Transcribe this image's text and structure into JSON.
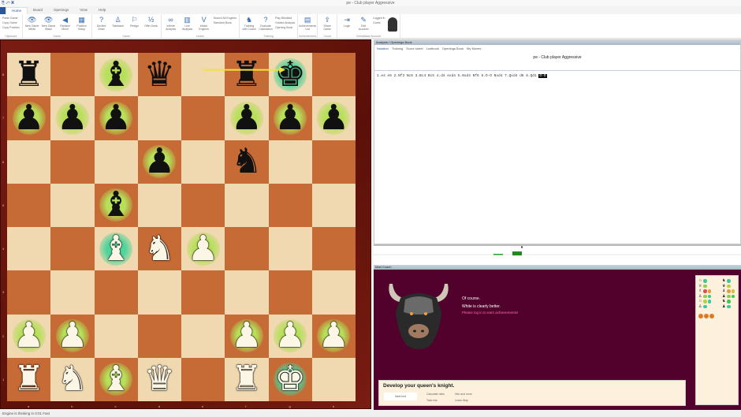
{
  "window": {
    "title": "pe - Club player Aggressive",
    "quick_access": "⎘ ↶ ▣"
  },
  "ribbon": {
    "tabs": [
      "Home",
      "Board",
      "Openings",
      "View",
      "Help"
    ],
    "groups": [
      {
        "label": "Clipboard",
        "small": [
          "Paste Game",
          "Copy Game",
          "Copy Position"
        ],
        "buttons": []
      },
      {
        "label": "Game",
        "buttons": [
          {
            "label": "New Game White",
            "icon": "👁"
          },
          {
            "label": "New Game Black",
            "icon": "👁"
          },
          {
            "label": "Replace Move",
            "icon": "◀"
          },
          {
            "label": "Position Setup",
            "icon": "▦"
          }
        ]
      },
      {
        "label": "Game",
        "buttons": [
          {
            "label": "Decline Draw",
            "icon": "?"
          },
          {
            "label": "Takeback",
            "icon": "♙"
          },
          {
            "label": "Resign",
            "icon": "⚐"
          },
          {
            "label": "Offer Draw",
            "icon": "½"
          }
        ]
      },
      {
        "label": "Levels",
        "buttons": [
          {
            "label": "Infinite Analysis",
            "icon": "∞"
          },
          {
            "label": "Live Analysis",
            "icon": "▥"
          },
          {
            "label": "Match Engines",
            "icon": "V"
          }
        ],
        "small": [
          "Search All Engines",
          "Standard Book"
        ]
      },
      {
        "label": "Training",
        "buttons": [
          {
            "label": "Training with Coach",
            "icon": "♞"
          },
          {
            "label": "Evaluate Calculation",
            "icon": "?"
          }
        ],
        "small": [
          "Play Blindfold",
          "Guided Analysis",
          "Opening Book"
        ]
      },
      {
        "label": "Achievements",
        "buttons": [
          {
            "label": "Achievements List",
            "icon": "▤"
          }
        ]
      },
      {
        "label": "Cloud",
        "buttons": [
          {
            "label": "Share Game",
            "icon": "⇪"
          }
        ]
      },
      {
        "label": "ChessBase Account",
        "buttons": [
          {
            "label": "Login",
            "icon": "⇥"
          },
          {
            "label": "Edit Account",
            "icon": "✎"
          }
        ],
        "small": [
          "Logged in",
          "Guest"
        ]
      }
    ]
  },
  "board": {
    "files": [
      "a",
      "b",
      "c",
      "d",
      "e",
      "f",
      "g",
      "h"
    ],
    "ranks": [
      "8",
      "7",
      "6",
      "5",
      "4",
      "3",
      "2",
      "1"
    ],
    "light": "#f0d9b0",
    "dark": "#c66a36",
    "position": [
      "r.bq.rk.",
      "ppp..ppp",
      "...p.n..",
      "..b.....",
      "..BNP...",
      "........",
      "PP...PPP",
      "RNBQ.RK."
    ],
    "arrow": {
      "from": "e8",
      "to": "g8",
      "color": "#f2e23a"
    }
  },
  "notation": {
    "panel_title": "Analysis / Openings Book",
    "tabs": [
      "Notation",
      "Training",
      "Score sheet",
      "Lostbook",
      "Openings Book",
      "My Moves"
    ],
    "game_title": "pe - Club player Aggressive",
    "moves": [
      "1.e4",
      "e5",
      "2.Nf3",
      "Nc6",
      "3.Bc4",
      "Bc5",
      "4.d4",
      "exd4",
      "5.Nxd4",
      "Nf6",
      "6.O-O",
      "Nxd4",
      "7.Qxd4",
      "d6",
      "8.Qd1"
    ],
    "current": "O-O"
  },
  "coach": {
    "panel_title": "Mad Coach",
    "messages": [
      "Of course.",
      "White is clearly better."
    ],
    "login_hint": "Please log in to earn achievements!",
    "task": "Develop your queen's knight.",
    "next_button": "Next hint",
    "options": [
      "Calculate risks",
      "Take risk",
      "Hint and more",
      "Learn Way"
    ]
  },
  "status": "Engine is thinking in 0:01 Fast"
}
